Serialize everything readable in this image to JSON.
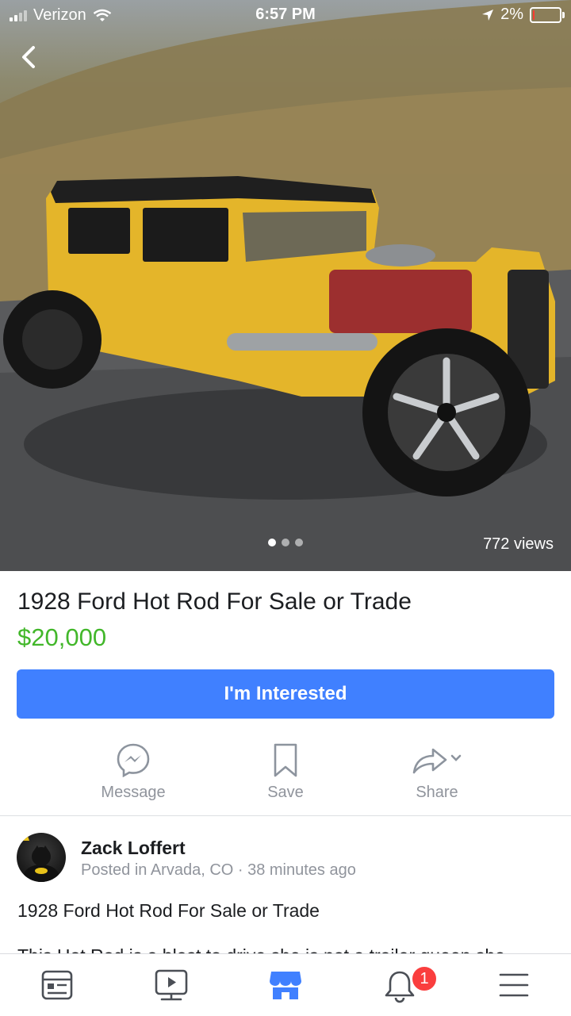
{
  "status_bar": {
    "carrier": "Verizon",
    "time": "6:57 PM",
    "battery": "2%",
    "battery_level": 0.02
  },
  "photo": {
    "views": "772 views",
    "page_count": 3,
    "active_page": 1
  },
  "listing": {
    "title": "1928 Ford Hot Rod For Sale or Trade",
    "price": "$20,000",
    "cta_label": "I'm Interested"
  },
  "actions": [
    {
      "label": "Message",
      "icon": "messenger-icon"
    },
    {
      "label": "Save",
      "icon": "bookmark-icon"
    },
    {
      "label": "Share",
      "icon": "share-icon"
    }
  ],
  "seller": {
    "name": "Zack Loffert",
    "meta": "Posted in Arvada, CO · 38 minutes ago"
  },
  "description": {
    "title": "1928 Ford Hot Rod For Sale or Trade",
    "body": "This Hot Rod is a blast to drive she is not a trailer queen she"
  },
  "tabbar": {
    "tabs": [
      "news-feed-icon",
      "video-icon",
      "marketplace-icon",
      "notifications-icon",
      "menu-icon"
    ],
    "active": "marketplace-icon",
    "notification_count": "1"
  },
  "colors": {
    "accent": "#4080ff",
    "price": "#42b72a",
    "badge": "#fa3e3e"
  }
}
